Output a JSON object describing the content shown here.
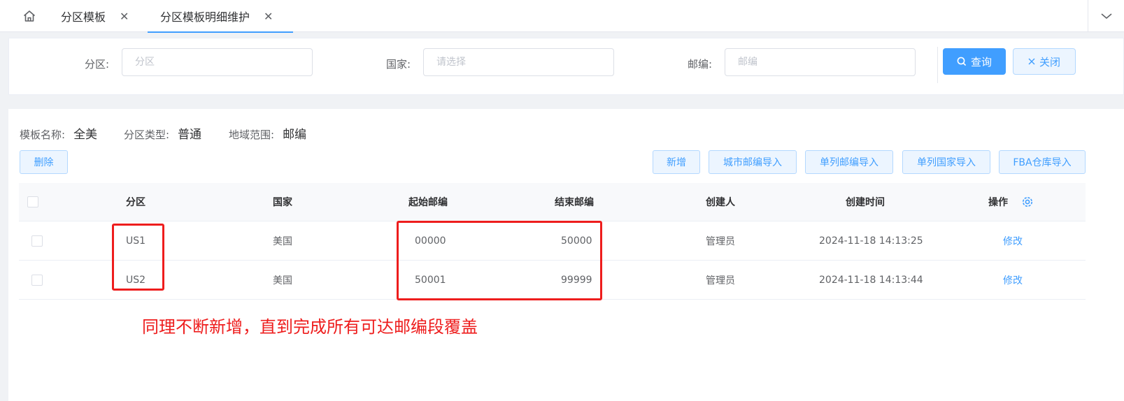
{
  "tabs": [
    {
      "label": "分区模板",
      "close": "✕",
      "active": false
    },
    {
      "label": "分区模板明细维护",
      "close": "✕",
      "active": true
    }
  ],
  "search": {
    "partition_label": "分区",
    "partition_placeholder": "分区",
    "country_label": "国家",
    "country_placeholder": "请选择",
    "zip_label": "邮编",
    "zip_placeholder": "邮编",
    "query_label": "查询",
    "close_label": "关闭"
  },
  "info": {
    "template_name_label": "模板名称:",
    "template_name_value": "全美",
    "partition_type_label": "分区类型:",
    "partition_type_value": "普通",
    "region_scope_label": "地域范围:",
    "region_scope_value": "邮编"
  },
  "toolbar": {
    "delete_label": "删除",
    "add_label": "新增",
    "city_zip_import_label": "城市邮编导入",
    "single_zip_import_label": "单列邮编导入",
    "single_country_import_label": "单列国家导入",
    "fba_import_label": "FBA仓库导入"
  },
  "table": {
    "headers": {
      "partition": "分区",
      "country": "国家",
      "start_zip": "起始邮编",
      "end_zip": "结束邮编",
      "creator": "创建人",
      "created_time": "创建时间",
      "action": "操作"
    },
    "rows": [
      {
        "partition": "US1",
        "country": "美国",
        "start_zip": "00000",
        "end_zip": "50000",
        "creator": "管理员",
        "created_time": "2024-11-18 14:13:25",
        "action": "修改"
      },
      {
        "partition": "US2",
        "country": "美国",
        "start_zip": "50001",
        "end_zip": "99999",
        "creator": "管理员",
        "created_time": "2024-11-18 14:13:44",
        "action": "修改"
      }
    ]
  },
  "annotation": "同理不断新增，直到完成所有可达邮编段覆盖",
  "colors": {
    "primary": "#409eff",
    "annotation_red": "#ee1d1d"
  },
  "icons": [
    "home-icon",
    "close-icon",
    "chevron-down-icon",
    "search-icon",
    "settings-icon"
  ]
}
